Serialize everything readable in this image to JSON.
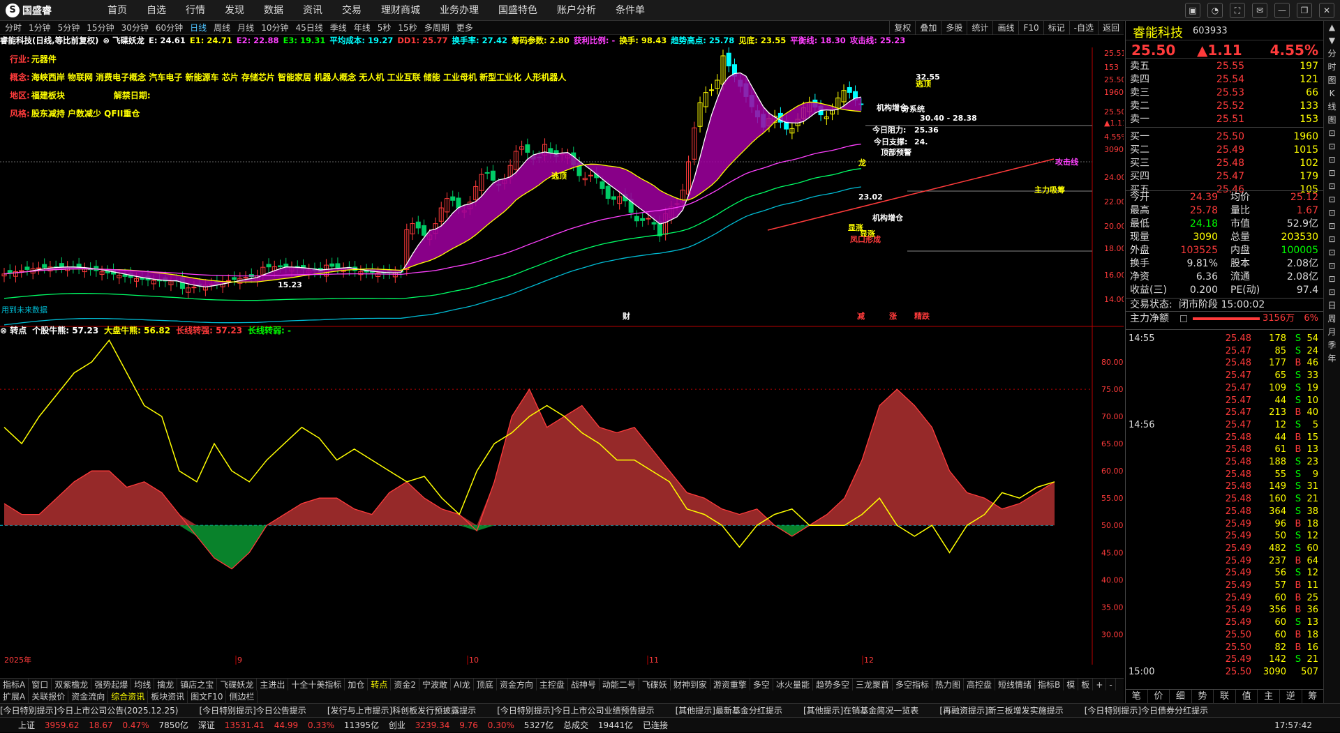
{
  "app": {
    "logo_text": "国盛睿",
    "logo_mark": "S"
  },
  "nav": [
    "首页",
    "自选",
    "行情",
    "发现",
    "数据",
    "资讯",
    "交易",
    "理财商城",
    "业务办理",
    "国盛特色",
    "账户分析",
    "条件单"
  ],
  "window_buttons": [
    "chat-icon",
    "bell-icon",
    "expand-icon",
    "skin-icon",
    "minimize-icon",
    "restore-icon",
    "close-icon"
  ],
  "window_glyphs": [
    "▣",
    "◔",
    "⛶",
    "✉",
    "—",
    "❐",
    "✕"
  ],
  "periods": [
    "分时",
    "1分钟",
    "5分钟",
    "15分钟",
    "30分钟",
    "60分钟",
    "日线",
    "周线",
    "月线",
    "10分钟",
    "45日线",
    "季线",
    "年线",
    "5秒",
    "15秒",
    "多周期",
    "更多"
  ],
  "period_selected": "日线",
  "right_tools": [
    "复权",
    "叠加",
    "多股",
    "统计",
    "画线",
    "F10",
    "标记",
    "-自选",
    "返回"
  ],
  "info_fields": [
    {
      "t": "睿能科技(日线,等比前复权)",
      "c": "#ffffff"
    },
    {
      "t": "⊗ 飞碟妖龙",
      "c": "#ffffff"
    },
    {
      "t": "E: 24.61",
      "c": "#ffffff"
    },
    {
      "t": "E1: 24.71",
      "c": "#ffff00"
    },
    {
      "t": "E2: 22.88",
      "c": "#ff40ff"
    },
    {
      "t": "E3: 19.31",
      "c": "#00ff00"
    },
    {
      "t": "平均成本: 19.27",
      "c": "#00ffff"
    },
    {
      "t": "DD1: 25.77",
      "c": "#ff3b3b"
    },
    {
      "t": "换手率: 27.42",
      "c": "#00ffff"
    },
    {
      "t": "筹码参数: 2.80",
      "c": "#ffff00"
    },
    {
      "t": "获利比例: -",
      "c": "#ff40ff"
    },
    {
      "t": "换手: 98.43",
      "c": "#ffff00"
    },
    {
      "t": "趋势高点: 25.78",
      "c": "#00ffff"
    },
    {
      "t": "见底: 23.55",
      "c": "#ffff00"
    },
    {
      "t": "平衡线: 18.30",
      "c": "#ff40ff"
    },
    {
      "t": "攻击线: 25.23",
      "c": "#ff40ff"
    }
  ],
  "stock_tags": [
    {
      "label": "行业:",
      "value": "元器件"
    },
    {
      "label": "概念:",
      "value": "海峡西岸 物联网 消费电子概念 汽车电子 新能源车 芯片 存储芯片 智能家居 机器人概念 无人机 工业互联 储能 工业母机 新型工业化 人形机器人"
    },
    {
      "label": "地区:",
      "value": "福建板块",
      "extra_label": "解禁日期:",
      "extra_value": ""
    },
    {
      "label": "风格:",
      "value": "股东减持 户数减少 QFII重仓"
    }
  ],
  "chart_data": [
    {
      "type": "candlestick",
      "title": "睿能科技(日线,等比前复权)",
      "y_ticks": [
        "25.51",
        "153",
        "25.50",
        "1960",
        "25.50",
        "▲1.11",
        "4.55%",
        "3090",
        "24.00",
        "22.00",
        "20.00",
        "18.00",
        "16.00",
        "14.00"
      ],
      "ylim": [
        14,
        27
      ],
      "x_labels": [
        "2025年",
        "9",
        "10",
        "11",
        "12"
      ],
      "annotations": [
        "32.55",
        "逃顶",
        "机构增仓",
        "分系统",
        "今日阻力:",
        "25.36",
        "今日支撑:",
        "24.",
        "顶部预警",
        "龙",
        "显涨",
        "凤口形成",
        "逃顶",
        "23.02",
        "显涨",
        "机构增仓",
        "15.23",
        "攻击线",
        "主力吸筹",
        "30.40 - 28.38",
        "财",
        "减",
        "涨",
        "精跌"
      ],
      "footer_note": "用到未来数据"
    },
    {
      "type": "line",
      "title": "转点",
      "y_ticks": [
        "80.00",
        "75.00",
        "70.00",
        "65.00",
        "60.00",
        "55.00",
        "50.00",
        "45.00",
        "40.00",
        "35.00",
        "30.00"
      ],
      "ylim": [
        28,
        85
      ],
      "series": [
        {
          "name": "个股牛熊",
          "values": [
            54,
            52,
            52,
            55,
            58,
            60,
            60,
            57,
            58,
            56,
            52,
            48,
            44,
            42,
            45,
            50,
            52,
            54,
            55,
            55,
            53,
            52,
            56,
            58,
            55,
            53,
            52,
            49,
            58,
            70,
            75,
            68,
            70,
            72,
            68,
            67,
            68,
            64,
            60,
            56,
            55,
            53,
            52,
            53,
            50,
            48,
            50,
            52,
            55,
            62,
            72,
            75,
            72,
            68,
            60,
            56,
            55,
            53,
            54,
            56,
            58
          ]
        },
        {
          "name": "大盘牛熊",
          "values": [
            68,
            65,
            70,
            74,
            78,
            80,
            84,
            78,
            72,
            70,
            60,
            58,
            65,
            60,
            58,
            62,
            65,
            68,
            66,
            62,
            64,
            62,
            60,
            58,
            59,
            55,
            52,
            60,
            65,
            67,
            70,
            72,
            70,
            67,
            65,
            62,
            62,
            60,
            58,
            53,
            52,
            50,
            46,
            50,
            52,
            53,
            50,
            50,
            50,
            52,
            55,
            50,
            48,
            50,
            45,
            50,
            52,
            56,
            55,
            57,
            58
          ]
        }
      ],
      "legend_values": {
        "个股牛熊": "57.23",
        "大盘牛熊": "56.82",
        "长线转强": "57.23",
        "长线转弱": "-"
      }
    }
  ],
  "sub_info": [
    {
      "t": "⊗ 转点",
      "c": "#ffffff"
    },
    {
      "t": "个股牛熊: 57.23",
      "c": "#ffffff"
    },
    {
      "t": "大盘牛熊: 56.82",
      "c": "#ffff00"
    },
    {
      "t": "长线转强: 57.23",
      "c": "#ff3b3b"
    },
    {
      "t": "长线转弱: -",
      "c": "#00ff00"
    }
  ],
  "x_axis_right_label": "日线",
  "bottom_tabs1": [
    "指标A",
    "窗口",
    "双紫檐龙",
    "强势起爆",
    "均线",
    "擒龙",
    "镇店之宝",
    "飞碟妖龙",
    "主进出",
    "十全十美指标",
    "加仓",
    "转点",
    "资金2",
    "宁波敢",
    "AI龙",
    "顶底",
    "资金方向",
    "主控盘",
    "战神号",
    "动能二号",
    "飞碟妖",
    "财神到家",
    "游资重擎",
    "多空",
    "冰火量能",
    "趋势多空",
    "三龙聚首",
    "多空指标",
    "热力图",
    "高控盘",
    "短线情绪",
    "指标B",
    "模",
    "板",
    "+",
    "-"
  ],
  "bottom_tabs1_selected": "转点",
  "bottom_tabs2": [
    "扩展A",
    "关联报价",
    "资金流向",
    "综合资讯",
    "板块资讯",
    "图文F10",
    "侧边栏"
  ],
  "bottom_tabs2_selected": "综合资讯",
  "news": [
    "[今日特别提示]今日上市公司公告(2025.12.25)",
    "[今日特别提示]今日公告提示",
    "[发行与上市提示]科创板发行预披露提示",
    "[今日特别提示]今日上市公司业绩预告提示",
    "[其他提示]最新基金分红提示",
    "[其他提示]在销基金简况一览表",
    "[再融资提示]新三板增发实施提示",
    "[今日特别提示]今日债券分红提示"
  ],
  "status": {
    "sh_label": "上证",
    "sh_val": "3959.62",
    "sh_chg": "18.67",
    "sh_pct": "0.47%",
    "sh_amt": "7850亿",
    "sz_label": "深证",
    "sz_val": "13531.41",
    "sz_chg": "44.99",
    "sz_pct": "0.33%",
    "sz_amt": "11395亿",
    "cy_label": "创业",
    "cy_val": "3239.34",
    "cy_chg": "9.76",
    "cy_pct": "0.30%",
    "cy_amt": "5327亿",
    "total_label": "总成交",
    "total_amt": "19441亿",
    "conn": "已连接",
    "time": "17:57:42"
  },
  "quote": {
    "name": "睿能科技",
    "code": "603933",
    "price": "25.50",
    "change": "▲1.11",
    "pct": "4.55%",
    "asks": [
      {
        "l": "卖五",
        "p": "25.55",
        "v": "197"
      },
      {
        "l": "卖四",
        "p": "25.54",
        "v": "121"
      },
      {
        "l": "卖三",
        "p": "25.53",
        "v": "66"
      },
      {
        "l": "卖二",
        "p": "25.52",
        "v": "133"
      },
      {
        "l": "卖一",
        "p": "25.51",
        "v": "153"
      }
    ],
    "bids": [
      {
        "l": "买一",
        "p": "25.50",
        "v": "1960"
      },
      {
        "l": "买二",
        "p": "25.49",
        "v": "1015"
      },
      {
        "l": "买三",
        "p": "25.48",
        "v": "102"
      },
      {
        "l": "买四",
        "p": "25.47",
        "v": "179"
      },
      {
        "l": "买五",
        "p": "25.46",
        "v": "105"
      }
    ],
    "stats": [
      {
        "l1": "今开",
        "v1": "24.39",
        "l2": "均价",
        "v2": "25.12"
      },
      {
        "l1": "最高",
        "v1": "25.78",
        "l2": "量比",
        "v2": "1.67"
      },
      {
        "l1": "最低",
        "v1": "24.18",
        "l2": "市值",
        "v2": "52.9亿"
      },
      {
        "l1": "现量",
        "v1": "3090",
        "l2": "总量",
        "v2": "203530"
      },
      {
        "l1": "外盘",
        "v1": "103525",
        "l2": "内盘",
        "v2": "100005"
      },
      {
        "l1": "换手",
        "v1": "9.81%",
        "l2": "股本",
        "v2": "2.08亿"
      },
      {
        "l1": "净资",
        "v1": "6.36",
        "l2": "流通",
        "v2": "2.08亿"
      },
      {
        "l1": "收益(三)",
        "v1": "0.200",
        "l2": "PE(动)",
        "v2": "97.4"
      }
    ],
    "trade_state_label": "交易状态:",
    "trade_state": "闭市阶段 15:00:02",
    "net_flow_label": "主力净额",
    "net_flow": "3156万",
    "net_flow_pct": "6%"
  },
  "ticks": [
    {
      "t": "14:55",
      "p": "25.48",
      "v": "178",
      "d": "S",
      "n": "54"
    },
    {
      "t": "",
      "p": "25.47",
      "v": "85",
      "d": "S",
      "n": "24"
    },
    {
      "t": "",
      "p": "25.48",
      "v": "177",
      "d": "B",
      "n": "46"
    },
    {
      "t": "",
      "p": "25.47",
      "v": "65",
      "d": "S",
      "n": "33"
    },
    {
      "t": "",
      "p": "25.47",
      "v": "109",
      "d": "S",
      "n": "19"
    },
    {
      "t": "",
      "p": "25.47",
      "v": "44",
      "d": "S",
      "n": "10"
    },
    {
      "t": "",
      "p": "25.47",
      "v": "213",
      "d": "B",
      "n": "40"
    },
    {
      "t": "14:56",
      "p": "25.47",
      "v": "12",
      "d": "S",
      "n": "5"
    },
    {
      "t": "",
      "p": "25.48",
      "v": "44",
      "d": "B",
      "n": "15"
    },
    {
      "t": "",
      "p": "25.48",
      "v": "61",
      "d": "B",
      "n": "13"
    },
    {
      "t": "",
      "p": "25.48",
      "v": "188",
      "d": "S",
      "n": "23"
    },
    {
      "t": "",
      "p": "25.48",
      "v": "55",
      "d": "S",
      "n": "9"
    },
    {
      "t": "",
      "p": "25.48",
      "v": "149",
      "d": "S",
      "n": "31"
    },
    {
      "t": "",
      "p": "25.48",
      "v": "160",
      "d": "S",
      "n": "21"
    },
    {
      "t": "",
      "p": "25.48",
      "v": "364",
      "d": "S",
      "n": "38"
    },
    {
      "t": "",
      "p": "25.49",
      "v": "96",
      "d": "B",
      "n": "18"
    },
    {
      "t": "",
      "p": "25.49",
      "v": "50",
      "d": "S",
      "n": "12"
    },
    {
      "t": "",
      "p": "25.49",
      "v": "482",
      "d": "S",
      "n": "60"
    },
    {
      "t": "",
      "p": "25.49",
      "v": "237",
      "d": "B",
      "n": "64"
    },
    {
      "t": "",
      "p": "25.49",
      "v": "56",
      "d": "S",
      "n": "12"
    },
    {
      "t": "",
      "p": "25.49",
      "v": "57",
      "d": "B",
      "n": "11"
    },
    {
      "t": "",
      "p": "25.49",
      "v": "60",
      "d": "B",
      "n": "25"
    },
    {
      "t": "",
      "p": "25.49",
      "v": "356",
      "d": "B",
      "n": "36"
    },
    {
      "t": "",
      "p": "25.49",
      "v": "60",
      "d": "S",
      "n": "13"
    },
    {
      "t": "",
      "p": "25.50",
      "v": "60",
      "d": "B",
      "n": "18"
    },
    {
      "t": "",
      "p": "25.50",
      "v": "82",
      "d": "B",
      "n": "16"
    },
    {
      "t": "",
      "p": "25.49",
      "v": "142",
      "d": "S",
      "n": "21"
    },
    {
      "t": "15:00",
      "p": "25.50",
      "v": "3090",
      "d": "",
      "n": "507"
    }
  ],
  "rp_tabs": [
    "笔",
    "价",
    "细",
    "势",
    "联",
    "值",
    "主",
    "逆",
    "筹"
  ],
  "rside_tabs": [
    "▲",
    "▼",
    "分",
    "时",
    "图",
    "K",
    "线",
    "图",
    "⊡",
    "⊡",
    "⊡",
    "⊡",
    "⊡",
    "⊡",
    "⊡",
    "⊡",
    "⊡",
    "⊡",
    "⊡",
    "⊡",
    "⊡",
    "日",
    "周",
    "月",
    "季",
    "年"
  ]
}
